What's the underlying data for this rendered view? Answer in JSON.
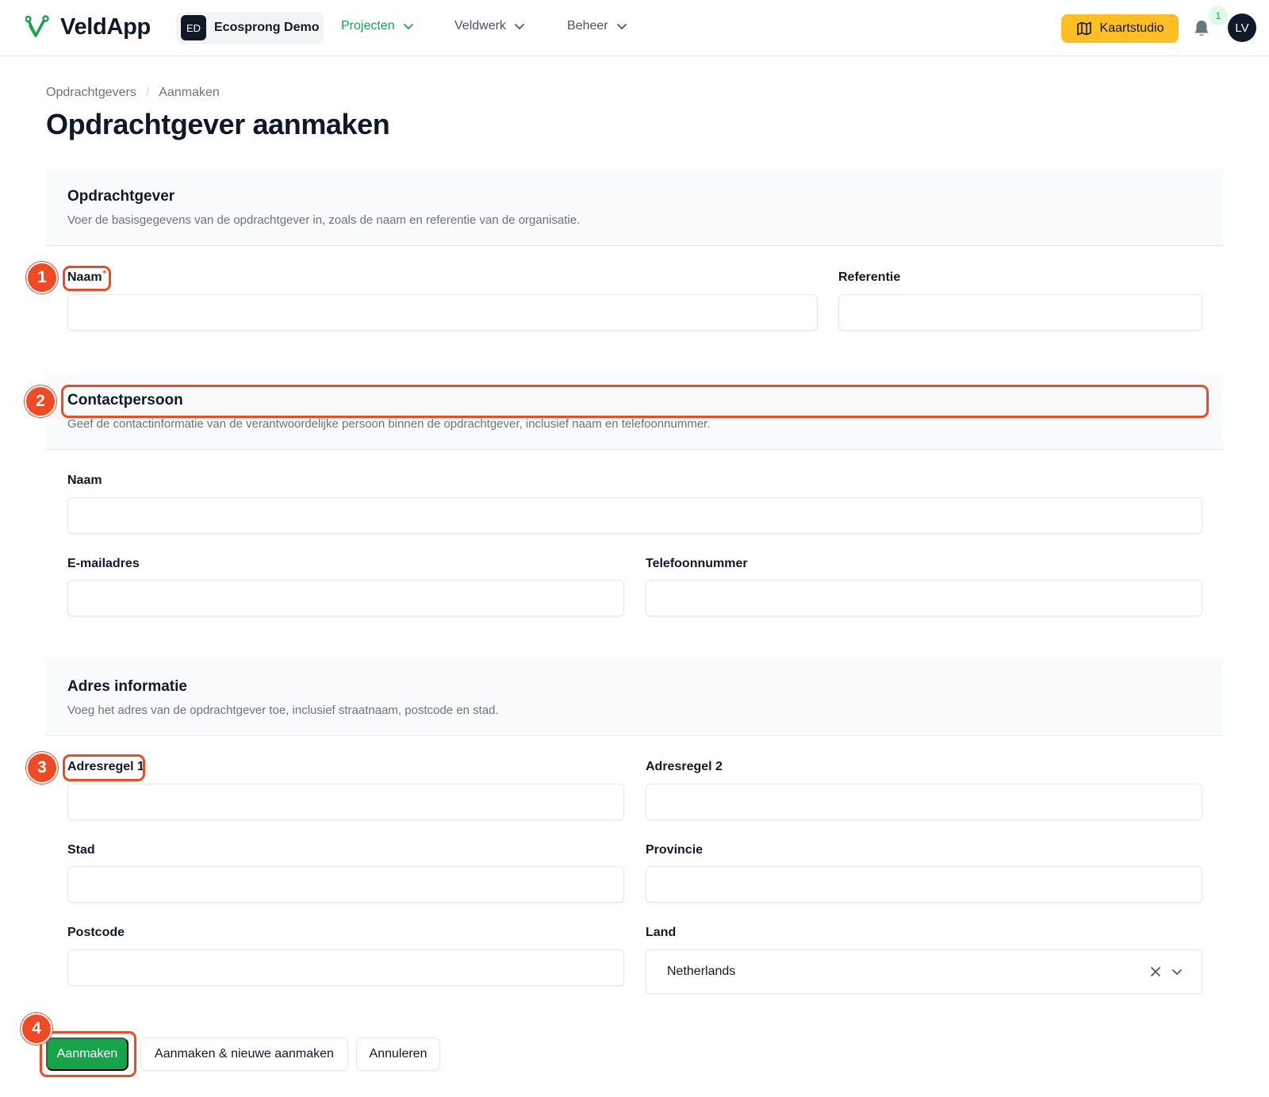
{
  "topbar": {
    "logo_text": "VeldApp",
    "org_badge": "ED",
    "org_name": "Ecosprong Demo",
    "nav": [
      {
        "label": "Projecten",
        "active": true
      },
      {
        "label": "Veldwerk",
        "active": false
      },
      {
        "label": "Beheer",
        "active": false
      }
    ],
    "map_button": "Kaartstudio",
    "notification_count": "1",
    "avatar_initials": "LV",
    "accent_color": "#16a34a",
    "map_button_color": "#fbbf24"
  },
  "breadcrumb": [
    "Opdrachtgevers",
    "Aanmaken"
  ],
  "page_title": "Opdrachtgever aanmaken",
  "sections": {
    "client": {
      "title": "Opdrachtgever",
      "description": "Voer de basisgegevens van de opdrachtgever in, zoals de naam en referentie van de organisatie.",
      "name_label": "Naam",
      "name_required": "*",
      "reference_label": "Referentie"
    },
    "contact": {
      "title": "Contactpersoon",
      "description": "Geef de contactinformatie van de verantwoordelijke persoon binnen de opdrachtgever, inclusief naam en telefoonnummer.",
      "name_label": "Naam",
      "email_label": "E-mailadres",
      "phone_label": "Telefoonnummer"
    },
    "address": {
      "title": "Adres informatie",
      "description": "Voeg het adres van de opdrachtgever toe, inclusief straatnaam, postcode en stad.",
      "line1_label": "Adresregel 1",
      "line2_label": "Adresregel 2",
      "city_label": "Stad",
      "province_label": "Provincie",
      "postcode_label": "Postcode",
      "country_label": "Land",
      "country_value": "Netherlands"
    }
  },
  "actions": {
    "create": "Aanmaken",
    "create_another": "Aanmaken & nieuwe aanmaken",
    "cancel": "Annuleren"
  },
  "callouts": {
    "markers": [
      "1",
      "2",
      "3",
      "4"
    ],
    "color": "#ef4a24"
  }
}
